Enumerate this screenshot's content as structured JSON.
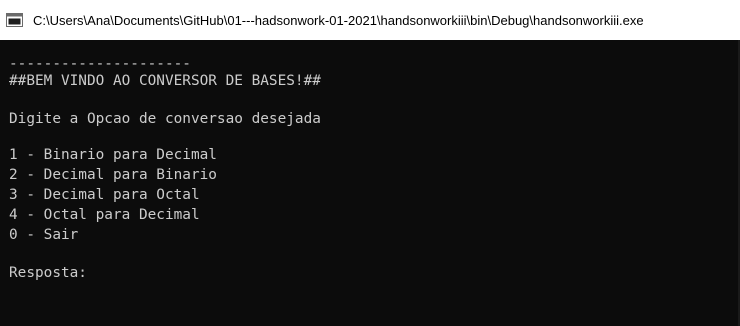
{
  "window": {
    "title": "C:\\Users\\Ana\\Documents\\GitHub\\01---hadsonwork-01-2021\\handsonworkiii\\bin\\Debug\\handsonworkiii.exe",
    "icon": "console-app-icon"
  },
  "console": {
    "separator": "---------------------",
    "welcome": "##BEM VINDO AO CONVERSOR DE BASES!##",
    "prompt": "Digite a Opcao de conversao desejada",
    "options": [
      "1 - Binario para Decimal",
      "2 - Decimal para Binario",
      "3 - Decimal para Octal",
      "4 - Octal para Decimal",
      "0 - Sair"
    ],
    "answer_label": "Resposta:"
  },
  "colors": {
    "console_background": "#0c0c0c",
    "console_text": "#cccccc",
    "titlebar_background": "#ffffff"
  }
}
